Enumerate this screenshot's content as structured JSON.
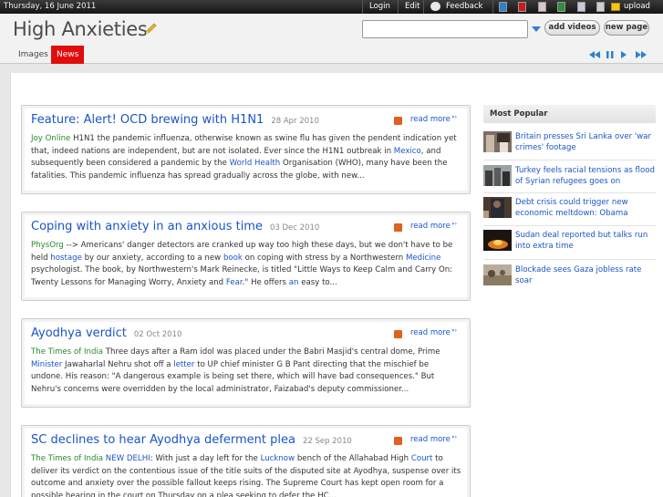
{
  "topbar": {
    "date": "Thursday, 16 June 2011",
    "login": "Login",
    "edit": "Edit",
    "feedback": "Feedback",
    "upload": "upload",
    "swatch_colors": [
      "#2f7fd0",
      "#d01a1a",
      "#d8c8c8",
      "#2e8f3a",
      "#c8c8d8",
      "#c8d0c8"
    ]
  },
  "header": {
    "logo": "High Anxieties",
    "search_value": "",
    "add_videos": "add videos",
    "new_page": "new page"
  },
  "nav": {
    "tabs": [
      {
        "label": "Images",
        "active": false
      },
      {
        "label": "News",
        "active": true
      }
    ],
    "media_controls": [
      "rewind-icon",
      "pause-icon",
      "play-icon",
      "fast-forward-icon"
    ]
  },
  "articles": [
    {
      "title": "Feature: Alert! OCD brewing with H1N1",
      "date": "28 Apr 2010",
      "source": "Joy Online",
      "readmore": "read more",
      "body": [
        {
          "t": "  H1N1 the pandemic influenza, otherwise known as swine flu has given the pendent indication yet that, indeed nations are independent, but are not isolated. Ever since the H1N1 outbreak in "
        },
        {
          "k": "Mexico"
        },
        {
          "t": ", and subsequently been considered a pandemic by the "
        },
        {
          "k": "World Health"
        },
        {
          "t": " Organisation (WHO), many have been the fatalities. This pandemic influenza has spread gradually across the globe, with new..."
        }
      ]
    },
    {
      "title": "Coping with anxiety in an anxious time",
      "date": "03 Dec 2010",
      "source": "PhysOrg",
      "readmore": "read more",
      "body": [
        {
          "t": "  --> Americans' danger detectors are cranked up way too high these days, but we don't have to be held "
        },
        {
          "k": "hostage"
        },
        {
          "t": " by our anxiety, according to a new "
        },
        {
          "k": "book"
        },
        {
          "t": " on coping with stress by a Northwestern "
        },
        {
          "k": "Medicine"
        },
        {
          "t": " psychologist. The book, by Northwestern's Mark Reinecke, is titled \"Little Ways to Keep Calm and Carry On: Twenty Lessons for Managing Worry, Anxiety and "
        },
        {
          "k": "Fear"
        },
        {
          "t": ".\" He offers "
        },
        {
          "k": "an"
        },
        {
          "t": " easy to..."
        }
      ]
    },
    {
      "title": "Ayodhya verdict",
      "date": "02 Oct 2010",
      "source": "The Times of India",
      "readmore": "read more",
      "body": [
        {
          "t": "  Three days after a Ram idol was placed under the Babri Masjid's central dome, Prime "
        },
        {
          "k": "Minister"
        },
        {
          "t": " Jawaharlal Nehru shot off a "
        },
        {
          "k": "letter"
        },
        {
          "t": " to UP chief minister G B Pant directing that the mischief be undone. His reason: \"A dangerous example is being set there, which will have bad consequences.\" But Nehru's concerns were overridden by the local administrator, Faizabad's deputy commissioner..."
        }
      ]
    },
    {
      "title": "SC declines to hear Ayodhya deferment plea",
      "date": "22 Sep 2010",
      "source": "The Times of India",
      "readmore": "read more",
      "body": [
        {
          "t": "  "
        },
        {
          "k": "NEW DELHI"
        },
        {
          "t": ": With just a day left for the "
        },
        {
          "k": "Lucknow"
        },
        {
          "t": " bench of the Allahabad High "
        },
        {
          "k": "Court"
        },
        {
          "t": " to deliver its verdict on the contentious issue of the title suits of the disputed site at Ayodhya, suspense over its outcome and anxiety over the possible fallout keeps rising. The Supreme Court has kept open room for a possible hearing in the court on Thursday on a plea seeking to defer the HC..."
        }
      ]
    }
  ],
  "popular": {
    "heading": "Most Popular",
    "items": [
      {
        "text": "Britain presses Sri Lanka over 'war crimes' footage"
      },
      {
        "text": "Turkey feels racial tensions as flood of Syrian refugees goes on"
      },
      {
        "text": "Debt crisis could trigger new economic meltdown: Obama"
      },
      {
        "text": "Sudan deal reported but talks run into extra time"
      },
      {
        "text": "Blockade sees Gaza jobless rate soar"
      }
    ]
  }
}
